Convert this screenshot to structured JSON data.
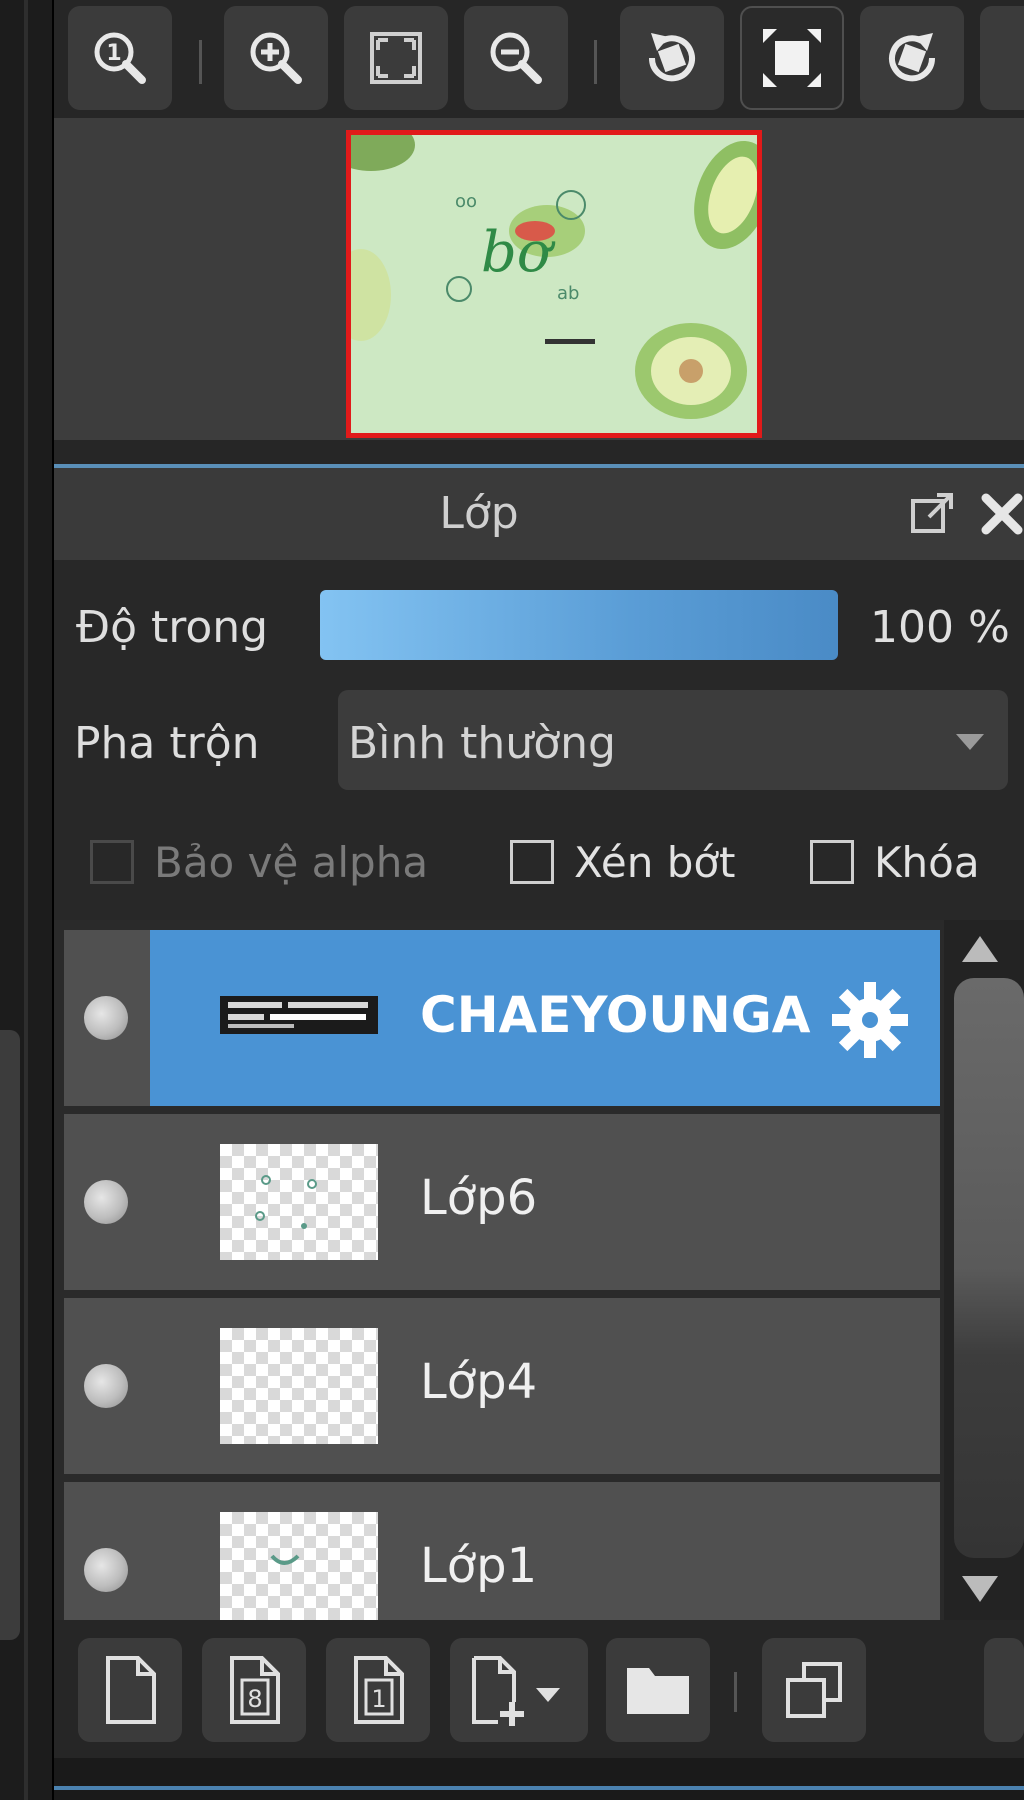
{
  "navigator": {
    "toolbar_icons": [
      "zoom-actual-size-icon",
      "zoom-in-icon",
      "fit-to-window-icon",
      "zoom-out-icon",
      "rotate-left-icon",
      "fit-canvas-icon",
      "rotate-right-icon"
    ]
  },
  "layer_panel": {
    "title": "Lớp",
    "opacity": {
      "label": "Độ trong",
      "value": "100 %",
      "fraction": 1.0
    },
    "blend": {
      "label": "Pha trộn",
      "value": "Bình thường"
    },
    "checkboxes": [
      {
        "label": "Bảo vệ alpha",
        "checked": false,
        "disabled": true
      },
      {
        "label": "Xén bớt",
        "checked": false,
        "disabled": false
      },
      {
        "label": "Khóa",
        "checked": false,
        "disabled": false
      }
    ],
    "layers": [
      {
        "name": "CHAEYOUNGA",
        "selected": true,
        "kind": "text"
      },
      {
        "name": "Lớp6",
        "selected": false,
        "kind": "raster"
      },
      {
        "name": "Lớp4",
        "selected": false,
        "kind": "raster"
      },
      {
        "name": "Lớp1",
        "selected": false,
        "kind": "raster"
      }
    ]
  },
  "bottom_toolbar": {
    "icons": [
      "new-layer-icon",
      "new-8bit-layer-icon",
      "new-1bit-layer-icon",
      "add-layer-dropdown-icon",
      "new-folder-icon",
      "duplicate-layer-icon"
    ]
  },
  "colors": {
    "accent_blue": "#4a93d4",
    "preview_border": "#e11a1a",
    "canvas_bg": "#cde8c3"
  }
}
